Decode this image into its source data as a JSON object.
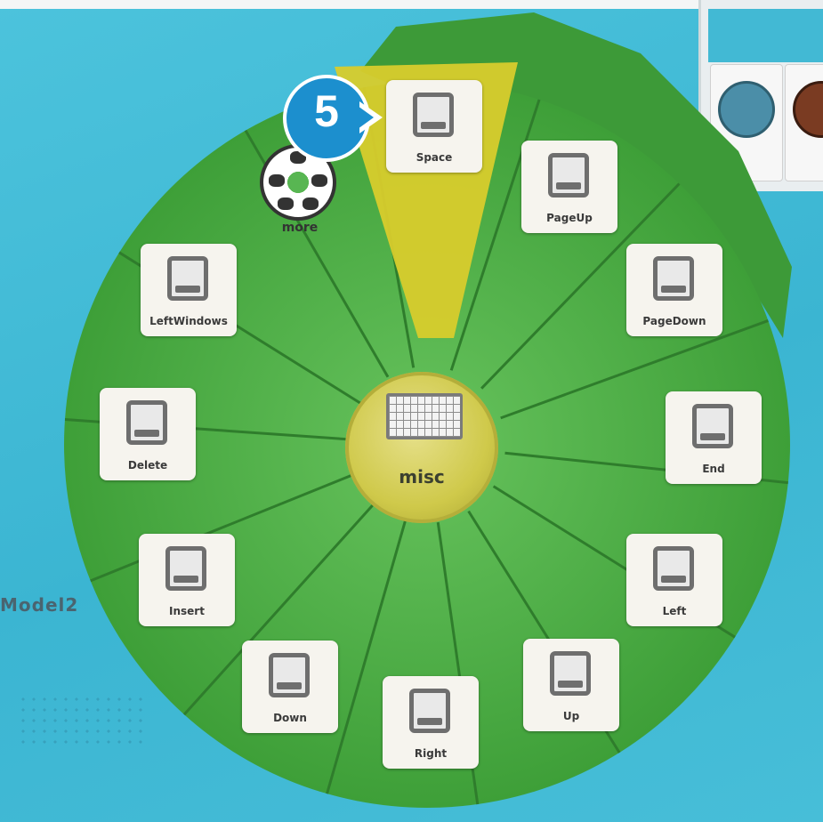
{
  "step_badge": {
    "number": "5"
  },
  "center": {
    "label": "misc",
    "icon": "keyboard-icon"
  },
  "more": {
    "label": "more",
    "icon": "soccer-ball-icon"
  },
  "highlighted_key": "Space",
  "keys": [
    {
      "label": "Space",
      "icon": "key-icon"
    },
    {
      "label": "PageUp",
      "icon": "key-icon"
    },
    {
      "label": "PageDown",
      "icon": "key-icon"
    },
    {
      "label": "End",
      "icon": "key-icon"
    },
    {
      "label": "Left",
      "icon": "key-icon"
    },
    {
      "label": "Up",
      "icon": "key-icon"
    },
    {
      "label": "Right",
      "icon": "key-icon"
    },
    {
      "label": "Down",
      "icon": "key-icon"
    },
    {
      "label": "Insert",
      "icon": "key-icon"
    },
    {
      "label": "Delete",
      "icon": "key-icon"
    },
    {
      "label": "LeftWindows",
      "icon": "key-icon"
    }
  ],
  "side_text": "Model2",
  "colors": {
    "wheel_green": "#4caf45",
    "wheel_dark_green": "#2f7d2c",
    "highlight_yellow": "#d8cc2c",
    "hub_yellow": "#cfc94a",
    "badge_blue": "#1c8fce",
    "background": "#3bb5d2"
  }
}
